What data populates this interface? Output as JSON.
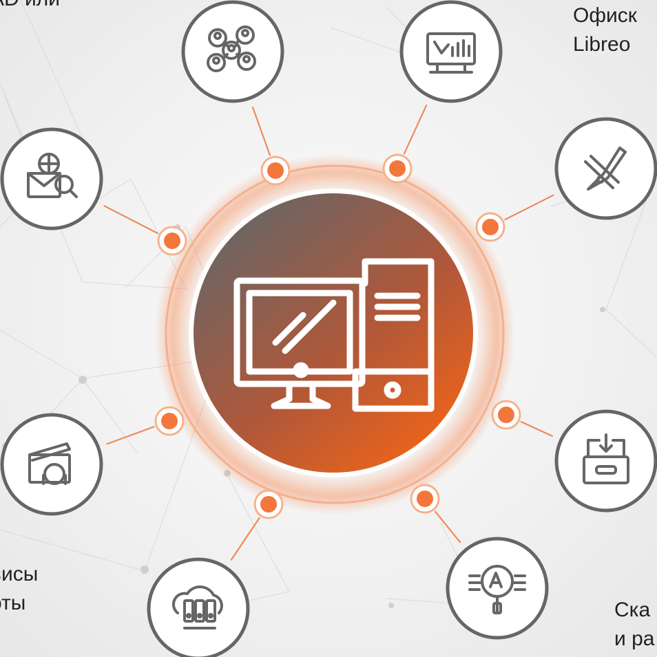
{
  "labels": {
    "top_left": "AD или",
    "top_right": "Офиск\nLibreo",
    "bottom_left": "висы\nоты",
    "bottom_right": "Ска\nи ра"
  },
  "colors": {
    "accent": "#f26522",
    "hub_dark": "#6e6260",
    "ring": "#f4a273",
    "icon_stroke": "#666666",
    "node_fill": "#f3773a"
  },
  "center": {
    "name": "computer-icon"
  },
  "satellites": [
    {
      "name": "network-people-icon"
    },
    {
      "name": "presentation-chart-icon"
    },
    {
      "name": "design-tools-icon"
    },
    {
      "name": "web-mail-search-icon"
    },
    {
      "name": "archive-download-icon"
    },
    {
      "name": "video-audio-icon"
    },
    {
      "name": "cloud-storage-icon"
    },
    {
      "name": "text-search-icon"
    }
  ]
}
